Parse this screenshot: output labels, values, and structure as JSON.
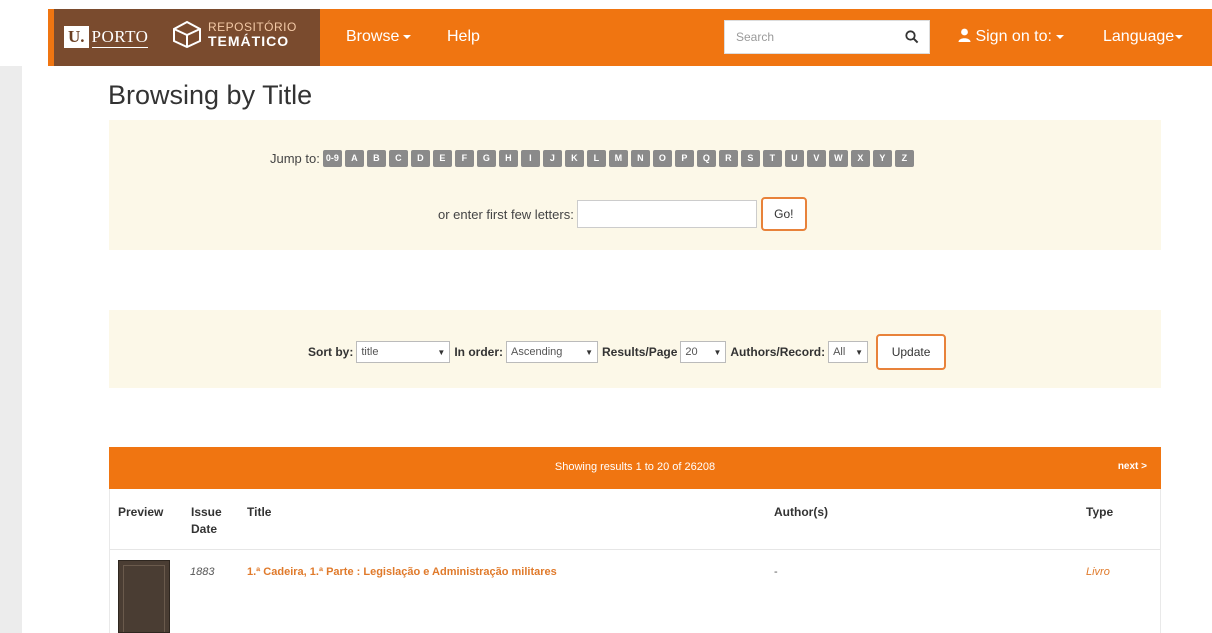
{
  "header": {
    "brand_u": "U.",
    "brand_porto": "PORTO",
    "repo_line1": "REPOSITÓRIO",
    "repo_line2": "TEMÁTICO",
    "nav_browse": "Browse",
    "nav_help": "Help",
    "search_placeholder": "Search",
    "sign_on": "Sign on to:",
    "language": "Language"
  },
  "page": {
    "title": "Browsing by Title"
  },
  "jump": {
    "label": "Jump to:",
    "letters": [
      "0-9",
      "A",
      "B",
      "C",
      "D",
      "E",
      "F",
      "G",
      "H",
      "I",
      "J",
      "K",
      "L",
      "M",
      "N",
      "O",
      "P",
      "Q",
      "R",
      "S",
      "T",
      "U",
      "V",
      "W",
      "X",
      "Y",
      "Z"
    ],
    "first_letters_label": "or enter first few letters:",
    "go_label": "Go!"
  },
  "sort": {
    "sort_by_label": "Sort by:",
    "sort_by_value": "title",
    "order_label": "In order:",
    "order_value": "Ascending",
    "results_label": "Results/Page",
    "results_value": "20",
    "authors_label": "Authors/Record:",
    "authors_value": "All",
    "update_label": "Update"
  },
  "results": {
    "summary": "Showing results 1 to 20 of 26208",
    "next": "next >",
    "columns": {
      "preview": "Preview",
      "issue_date_1": "Issue",
      "issue_date_2": "Date",
      "title": "Title",
      "authors": "Author(s)",
      "type": "Type"
    },
    "rows": [
      {
        "date": "1883",
        "title": "1.ª Cadeira, 1.ª Parte : Legislação e Administração militares",
        "author": "-",
        "type": "Livro"
      }
    ]
  },
  "colors": {
    "accent": "#f07511",
    "brand_dark": "#7a4b2e",
    "panel_bg": "#fcf8e8",
    "link": "#e07a2b"
  }
}
